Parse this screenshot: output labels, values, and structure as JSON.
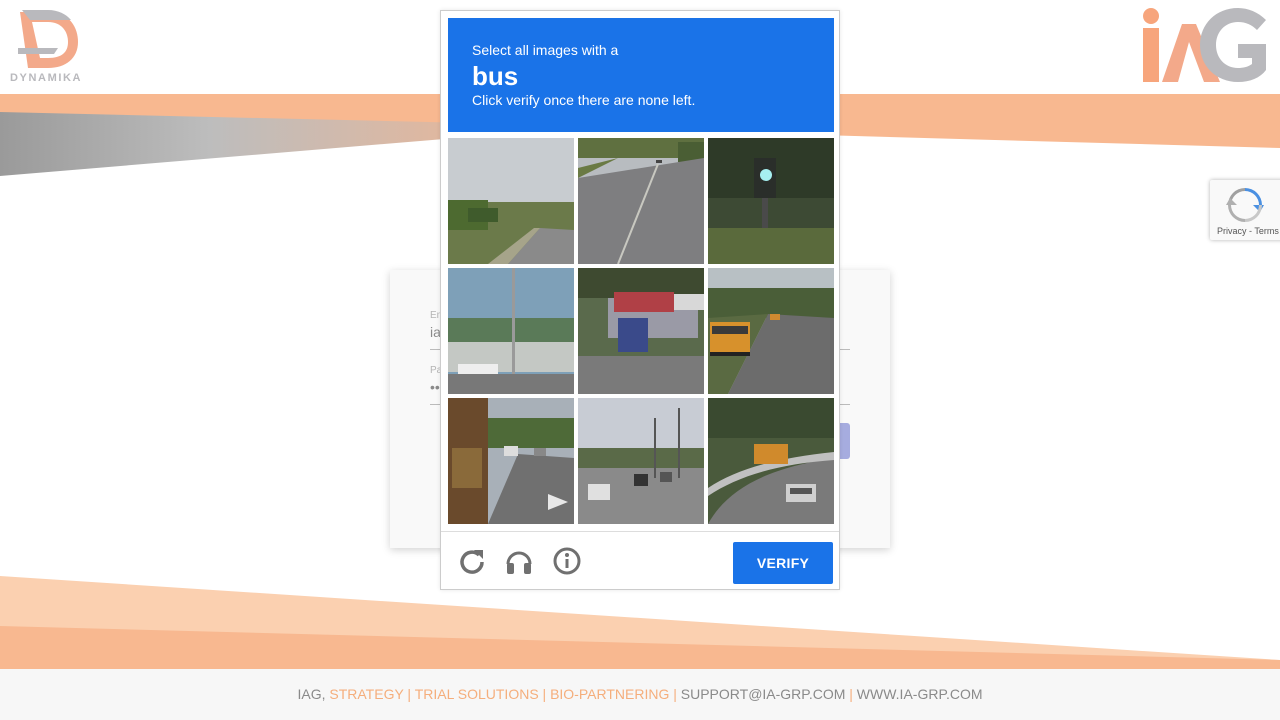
{
  "colors": {
    "accent_blue": "#1a73e8",
    "brand_orange": "#f7b48c",
    "brand_gray": "#b9b9bd",
    "footer_orange": "#f5ae7c"
  },
  "header": {
    "left_logo_text": "DYNAMIKA",
    "left_logo_icon": "dynamika-logo-icon",
    "right_logo_icon": "iag-logo-icon"
  },
  "login": {
    "email_label": "Em",
    "email_value": "ia",
    "password_label": "Pa",
    "password_value": "••"
  },
  "captcha": {
    "instruction_line1": "Select all images with a",
    "target_word": "bus",
    "instruction_line3": "Click verify once there are none left.",
    "tiles": [
      {
        "scene": "road-trees"
      },
      {
        "scene": "highway"
      },
      {
        "scene": "traffic-light"
      },
      {
        "scene": "overpass"
      },
      {
        "scene": "parked-car"
      },
      {
        "scene": "school-bus-road"
      },
      {
        "scene": "bus-side-street"
      },
      {
        "scene": "intersection"
      },
      {
        "scene": "bus-on-curve"
      }
    ],
    "reload_icon": "reload-icon",
    "audio_icon": "headphones-icon",
    "info_icon": "info-icon",
    "verify_label": "VERIFY"
  },
  "badge": {
    "text": "Privacy - Terms"
  },
  "footer": {
    "iag": "IAG,",
    "links": "STRATEGY | TRIAL SOLUTIONS | BIO-PARTNERING |",
    "email": "SUPPORT@IA-GRP.COM",
    "sep": "|",
    "web": "WWW.IA-GRP.COM"
  }
}
